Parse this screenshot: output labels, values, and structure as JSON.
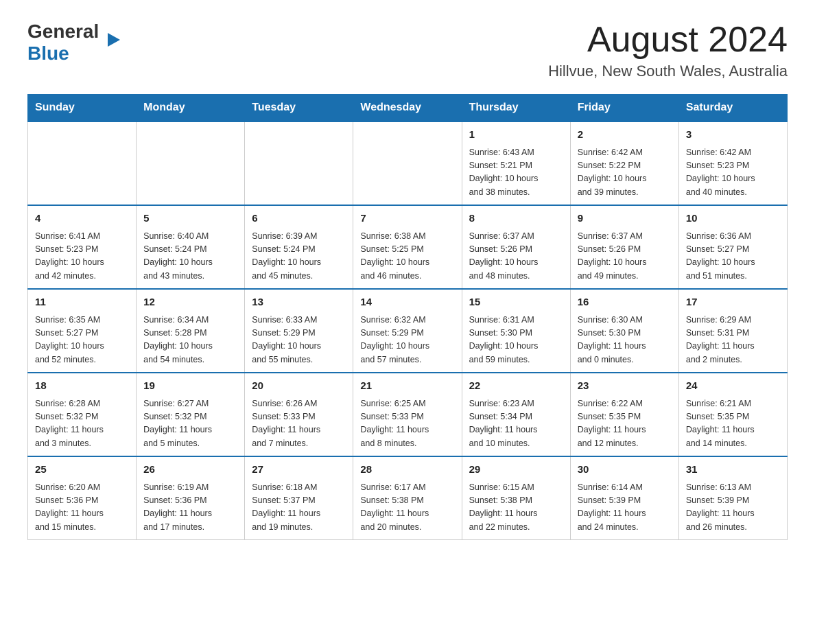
{
  "header": {
    "logo_general": "General",
    "logo_blue": "Blue",
    "month_title": "August 2024",
    "location": "Hillvue, New South Wales, Australia"
  },
  "days_of_week": [
    "Sunday",
    "Monday",
    "Tuesday",
    "Wednesday",
    "Thursday",
    "Friday",
    "Saturday"
  ],
  "weeks": [
    [
      {
        "day": "",
        "info": ""
      },
      {
        "day": "",
        "info": ""
      },
      {
        "day": "",
        "info": ""
      },
      {
        "day": "",
        "info": ""
      },
      {
        "day": "1",
        "info": "Sunrise: 6:43 AM\nSunset: 5:21 PM\nDaylight: 10 hours\nand 38 minutes."
      },
      {
        "day": "2",
        "info": "Sunrise: 6:42 AM\nSunset: 5:22 PM\nDaylight: 10 hours\nand 39 minutes."
      },
      {
        "day": "3",
        "info": "Sunrise: 6:42 AM\nSunset: 5:23 PM\nDaylight: 10 hours\nand 40 minutes."
      }
    ],
    [
      {
        "day": "4",
        "info": "Sunrise: 6:41 AM\nSunset: 5:23 PM\nDaylight: 10 hours\nand 42 minutes."
      },
      {
        "day": "5",
        "info": "Sunrise: 6:40 AM\nSunset: 5:24 PM\nDaylight: 10 hours\nand 43 minutes."
      },
      {
        "day": "6",
        "info": "Sunrise: 6:39 AM\nSunset: 5:24 PM\nDaylight: 10 hours\nand 45 minutes."
      },
      {
        "day": "7",
        "info": "Sunrise: 6:38 AM\nSunset: 5:25 PM\nDaylight: 10 hours\nand 46 minutes."
      },
      {
        "day": "8",
        "info": "Sunrise: 6:37 AM\nSunset: 5:26 PM\nDaylight: 10 hours\nand 48 minutes."
      },
      {
        "day": "9",
        "info": "Sunrise: 6:37 AM\nSunset: 5:26 PM\nDaylight: 10 hours\nand 49 minutes."
      },
      {
        "day": "10",
        "info": "Sunrise: 6:36 AM\nSunset: 5:27 PM\nDaylight: 10 hours\nand 51 minutes."
      }
    ],
    [
      {
        "day": "11",
        "info": "Sunrise: 6:35 AM\nSunset: 5:27 PM\nDaylight: 10 hours\nand 52 minutes."
      },
      {
        "day": "12",
        "info": "Sunrise: 6:34 AM\nSunset: 5:28 PM\nDaylight: 10 hours\nand 54 minutes."
      },
      {
        "day": "13",
        "info": "Sunrise: 6:33 AM\nSunset: 5:29 PM\nDaylight: 10 hours\nand 55 minutes."
      },
      {
        "day": "14",
        "info": "Sunrise: 6:32 AM\nSunset: 5:29 PM\nDaylight: 10 hours\nand 57 minutes."
      },
      {
        "day": "15",
        "info": "Sunrise: 6:31 AM\nSunset: 5:30 PM\nDaylight: 10 hours\nand 59 minutes."
      },
      {
        "day": "16",
        "info": "Sunrise: 6:30 AM\nSunset: 5:30 PM\nDaylight: 11 hours\nand 0 minutes."
      },
      {
        "day": "17",
        "info": "Sunrise: 6:29 AM\nSunset: 5:31 PM\nDaylight: 11 hours\nand 2 minutes."
      }
    ],
    [
      {
        "day": "18",
        "info": "Sunrise: 6:28 AM\nSunset: 5:32 PM\nDaylight: 11 hours\nand 3 minutes."
      },
      {
        "day": "19",
        "info": "Sunrise: 6:27 AM\nSunset: 5:32 PM\nDaylight: 11 hours\nand 5 minutes."
      },
      {
        "day": "20",
        "info": "Sunrise: 6:26 AM\nSunset: 5:33 PM\nDaylight: 11 hours\nand 7 minutes."
      },
      {
        "day": "21",
        "info": "Sunrise: 6:25 AM\nSunset: 5:33 PM\nDaylight: 11 hours\nand 8 minutes."
      },
      {
        "day": "22",
        "info": "Sunrise: 6:23 AM\nSunset: 5:34 PM\nDaylight: 11 hours\nand 10 minutes."
      },
      {
        "day": "23",
        "info": "Sunrise: 6:22 AM\nSunset: 5:35 PM\nDaylight: 11 hours\nand 12 minutes."
      },
      {
        "day": "24",
        "info": "Sunrise: 6:21 AM\nSunset: 5:35 PM\nDaylight: 11 hours\nand 14 minutes."
      }
    ],
    [
      {
        "day": "25",
        "info": "Sunrise: 6:20 AM\nSunset: 5:36 PM\nDaylight: 11 hours\nand 15 minutes."
      },
      {
        "day": "26",
        "info": "Sunrise: 6:19 AM\nSunset: 5:36 PM\nDaylight: 11 hours\nand 17 minutes."
      },
      {
        "day": "27",
        "info": "Sunrise: 6:18 AM\nSunset: 5:37 PM\nDaylight: 11 hours\nand 19 minutes."
      },
      {
        "day": "28",
        "info": "Sunrise: 6:17 AM\nSunset: 5:38 PM\nDaylight: 11 hours\nand 20 minutes."
      },
      {
        "day": "29",
        "info": "Sunrise: 6:15 AM\nSunset: 5:38 PM\nDaylight: 11 hours\nand 22 minutes."
      },
      {
        "day": "30",
        "info": "Sunrise: 6:14 AM\nSunset: 5:39 PM\nDaylight: 11 hours\nand 24 minutes."
      },
      {
        "day": "31",
        "info": "Sunrise: 6:13 AM\nSunset: 5:39 PM\nDaylight: 11 hours\nand 26 minutes."
      }
    ]
  ]
}
